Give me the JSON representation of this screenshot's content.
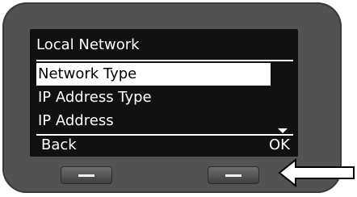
{
  "screen": {
    "title": "Local Network",
    "menu_items": [
      {
        "label": "Network Type",
        "selected": true
      },
      {
        "label": "IP Address Type",
        "selected": false
      },
      {
        "label": "IP Address",
        "selected": false
      }
    ],
    "more_items_indicator": "chevron-down-icon"
  },
  "softkeys": {
    "left_label": "Back",
    "right_label": "OK"
  },
  "annotation": {
    "pointer": "left-arrow-outline",
    "points_to": "right hardware softkey"
  },
  "colors": {
    "housing": "#525252",
    "display_bg": "#111111",
    "display_text": "#ffffff",
    "selection_bg": "#ffffff",
    "selection_text": "#000000"
  }
}
